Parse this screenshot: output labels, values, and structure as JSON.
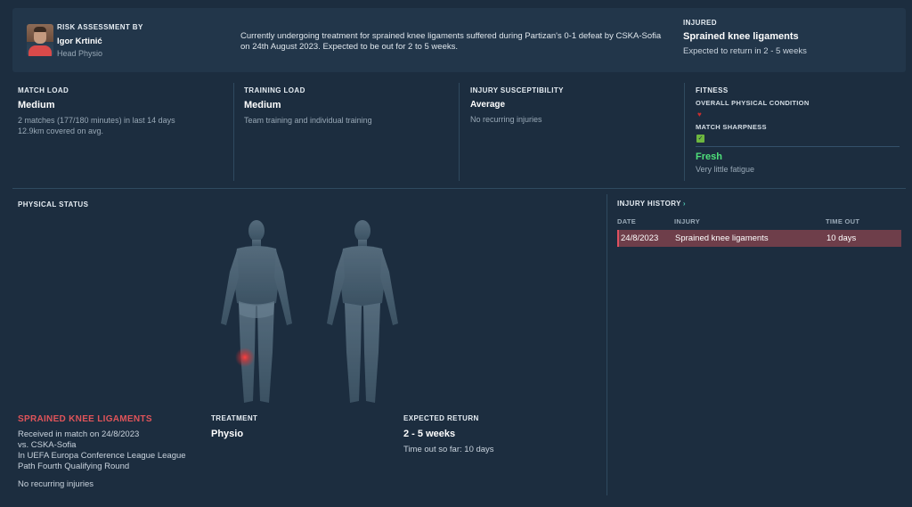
{
  "header": {
    "assessment_label": "RISK ASSESSMENT BY",
    "physio_name": "Igor Krtinić",
    "physio_role": "Head Physio",
    "description": "Currently undergoing treatment for sprained knee ligaments suffered during Partizan's 0-1 defeat by CSKA-Sofia on 24th August 2023. Expected to be out for 2 to 5 weeks.",
    "status_label": "INJURED",
    "injury_name": "Sprained knee ligaments",
    "expected_return": "Expected to return in 2 - 5 weeks"
  },
  "match_load": {
    "label": "MATCH LOAD",
    "value": "Medium",
    "line1": "2 matches (177/180 minutes) in last 14 days",
    "line2": "12.9km covered on avg."
  },
  "training_load": {
    "label": "TRAINING LOAD",
    "value": "Medium",
    "line1": "Team training and individual training"
  },
  "injury_susceptibility": {
    "label": "INJURY SUSCEPTIBILITY",
    "value": "Average",
    "line1": "No recurring injuries"
  },
  "fitness": {
    "label": "FITNESS",
    "overall_label": "OVERALL PHYSICAL CONDITION",
    "sharpness_label": "MATCH SHARPNESS",
    "state": "Fresh",
    "state_sub": "Very little fatigue",
    "heart_icon": "heart-icon",
    "sharpness_icon": "check-icon"
  },
  "physical_status": {
    "label": "PHYSICAL STATUS",
    "injury_title": "SPRAINED KNEE LIGAMENTS",
    "injury_lines": [
      "Received in match on 24/8/2023",
      "vs. CSKA-Sofia",
      "In UEFA Europa Conference League League",
      "Path Fourth Qualifying Round"
    ],
    "recurring": "No recurring injuries",
    "treatment_label": "TREATMENT",
    "treatment_value": "Physio",
    "expected_label": "EXPECTED RETURN",
    "expected_value": "2 - 5 weeks",
    "time_out": "Time out so far: 10 days"
  },
  "injury_history": {
    "title": "INJURY HISTORY",
    "columns": [
      "DATE",
      "INJURY",
      "TIME OUT"
    ],
    "rows": [
      {
        "date": "24/8/2023",
        "injury": "Sprained knee ligaments",
        "time_out": "10 days"
      }
    ]
  },
  "colors": {
    "background": "#1c2d3f",
    "injury_red": "#e0545a",
    "fresh_green": "#4fe07a",
    "history_row": "#6e3e4a"
  }
}
